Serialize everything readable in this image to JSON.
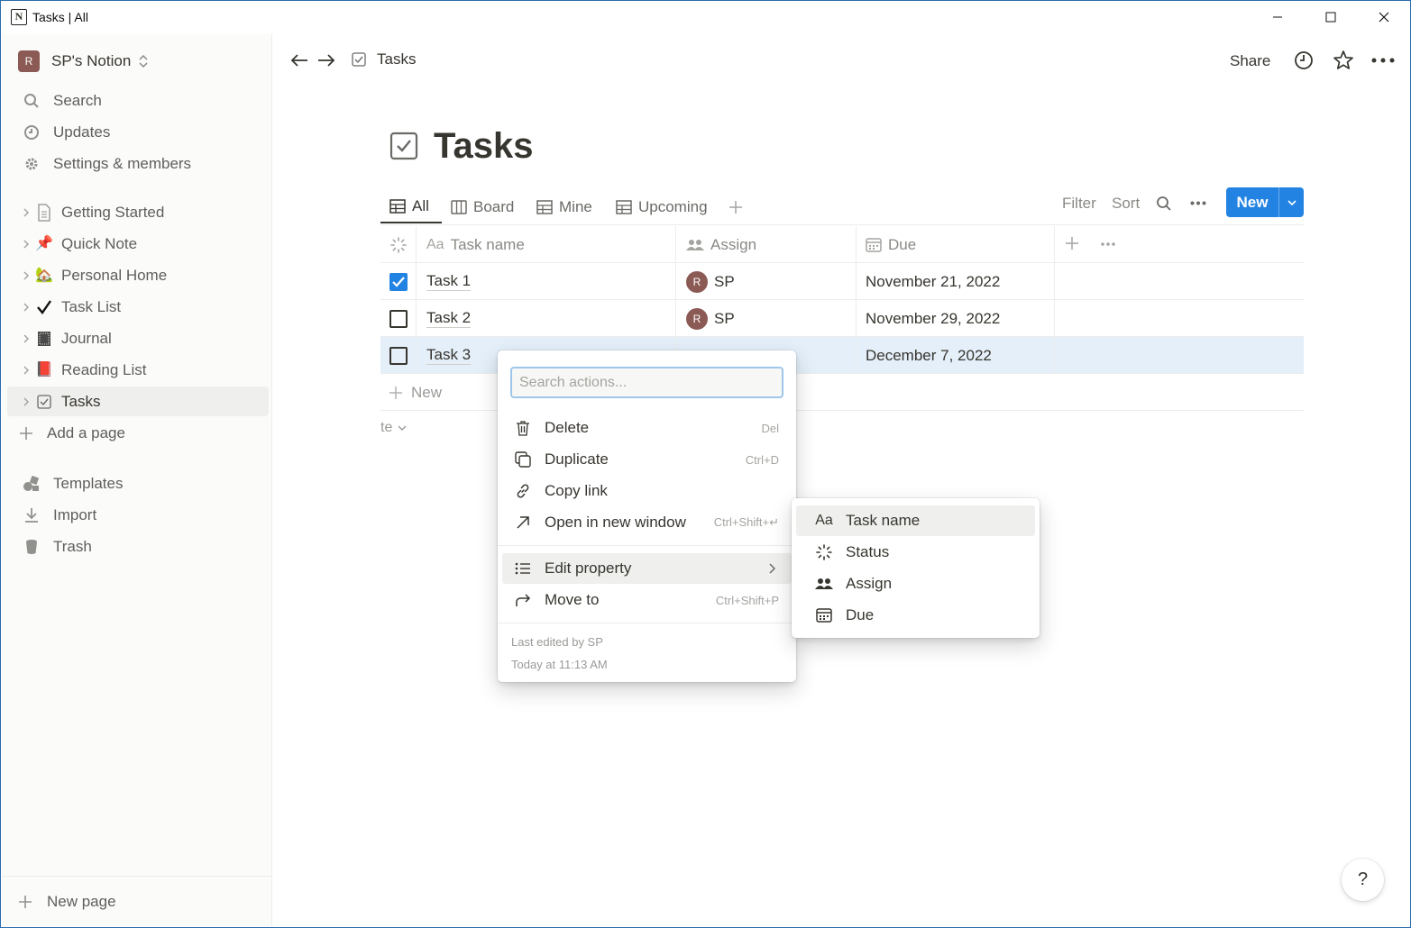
{
  "window": {
    "title": "Tasks | All",
    "app_icon": "N"
  },
  "sidebar": {
    "workspace": {
      "avatar": "R",
      "name": "SP's Notion"
    },
    "top_items": [
      {
        "label": "Search",
        "icon": "search-icon"
      },
      {
        "label": "Updates",
        "icon": "clock-icon"
      },
      {
        "label": "Settings & members",
        "icon": "gear-icon"
      }
    ],
    "pages": [
      {
        "label": "Getting Started",
        "icon": "document-icon"
      },
      {
        "label": "Quick Note",
        "icon": "📌"
      },
      {
        "label": "Personal Home",
        "icon": "🏡"
      },
      {
        "label": "Task List",
        "icon": "✔"
      },
      {
        "label": "Journal",
        "icon": "🁢"
      },
      {
        "label": "Reading List",
        "icon": "📕"
      },
      {
        "label": "Tasks",
        "icon": "checkbox-icon",
        "active": true
      }
    ],
    "add_page": "Add a page",
    "bottom_items": [
      {
        "label": "Templates",
        "icon": "shapes-icon"
      },
      {
        "label": "Import",
        "icon": "download-icon"
      },
      {
        "label": "Trash",
        "icon": "trash-icon"
      }
    ],
    "new_page": "New page"
  },
  "topbar": {
    "breadcrumb": "Tasks",
    "share": "Share"
  },
  "page": {
    "title": "Tasks"
  },
  "views": {
    "tabs": [
      {
        "label": "All",
        "icon": "table-icon",
        "active": true
      },
      {
        "label": "Board",
        "icon": "board-icon"
      },
      {
        "label": "Mine",
        "icon": "table-icon"
      },
      {
        "label": "Upcoming",
        "icon": "table-icon"
      }
    ],
    "filter": "Filter",
    "sort": "Sort",
    "new_button": "New"
  },
  "table": {
    "columns": [
      "Task name",
      "Assign",
      "Due"
    ],
    "column_icons": [
      "text-icon",
      "people-icon",
      "calendar-icon"
    ],
    "rows": [
      {
        "name": "Task 1",
        "assign_avatar": "R",
        "assign": "SP",
        "due": "November 21, 2022",
        "done": true
      },
      {
        "name": "Task 2",
        "assign_avatar": "R",
        "assign": "SP",
        "due": "November 29, 2022",
        "done": false
      },
      {
        "name": "Task 3",
        "assign_avatar": "",
        "assign": "",
        "due": "December 7, 2022",
        "done": false,
        "selected": true
      }
    ],
    "new_row": "New",
    "calculate": "te"
  },
  "context_menu": {
    "search_placeholder": "Search actions...",
    "items": [
      {
        "label": "Delete",
        "shortcut": "Del",
        "icon": "trash-icon"
      },
      {
        "label": "Duplicate",
        "shortcut": "Ctrl+D",
        "icon": "duplicate-icon"
      },
      {
        "label": "Copy link",
        "shortcut": "",
        "icon": "link-icon"
      },
      {
        "label": "Open in new window",
        "shortcut": "Ctrl+Shift+↵",
        "icon": "arrow-up-right-icon"
      }
    ],
    "items2": [
      {
        "label": "Edit property",
        "shortcut": "",
        "icon": "list-icon",
        "has_submenu": true,
        "highlighted": true
      },
      {
        "label": "Move to",
        "shortcut": "Ctrl+Shift+P",
        "icon": "move-arrow-icon"
      }
    ],
    "last_edited_by": "Last edited by SP",
    "last_edited_time": "Today at 11:13 AM"
  },
  "submenu": {
    "items": [
      {
        "label": "Task name",
        "icon": "text-icon",
        "highlighted": true
      },
      {
        "label": "Status",
        "icon": "status-icon"
      },
      {
        "label": "Assign",
        "icon": "people-icon"
      },
      {
        "label": "Due",
        "icon": "calendar-icon"
      }
    ]
  },
  "help": "?",
  "colors": {
    "accent": "#2383e2",
    "selected_row": "#e4eff9",
    "avatar": "#8b5a55"
  }
}
